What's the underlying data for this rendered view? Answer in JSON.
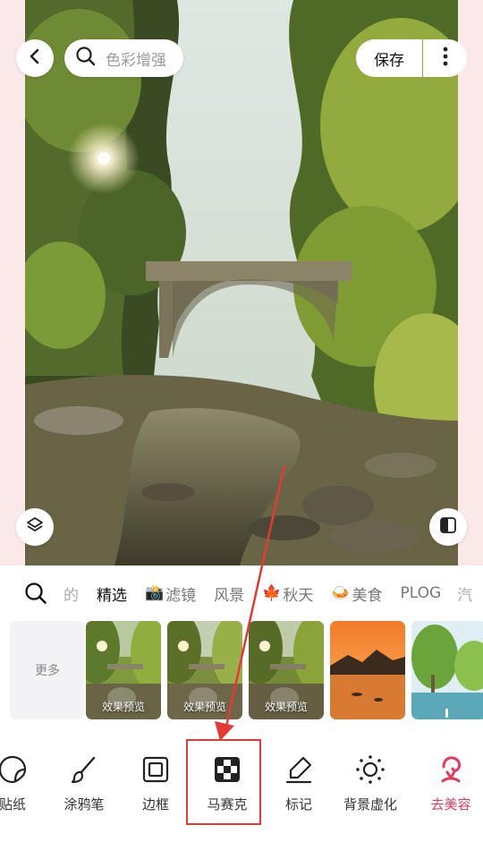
{
  "header": {
    "search_placeholder": "色彩增强",
    "save_label": "保存"
  },
  "filter_tabs": {
    "items": [
      {
        "label": "的",
        "emoji": "",
        "state": "partial"
      },
      {
        "label": "精选",
        "emoji": "",
        "state": "active"
      },
      {
        "label": "滤镜",
        "emoji": "📸",
        "state": "normal"
      },
      {
        "label": "风景",
        "emoji": "",
        "state": "normal"
      },
      {
        "label": "秋天",
        "emoji": "🍁",
        "state": "normal"
      },
      {
        "label": "美食",
        "emoji": "🍛",
        "state": "normal"
      },
      {
        "label": "PLOG",
        "emoji": "",
        "state": "normal"
      },
      {
        "label": "汽",
        "emoji": "",
        "state": "partial"
      }
    ]
  },
  "thumbnails": {
    "more_label": "更多",
    "preview_caption": "效果预览"
  },
  "tools": {
    "sticker": "贴纸",
    "brush": "涂鸦笔",
    "frame": "边框",
    "mosaic": "马赛克",
    "mark": "标记",
    "bg_blur": "背景虚化",
    "beauty": "去美容"
  },
  "colors": {
    "accent_red": "#e23a35",
    "beauty_pink": "#e33a5e",
    "photo_margin": "#fbe9e9"
  },
  "icons": [
    "chevron-left-icon",
    "search-icon",
    "more-vertical-icon",
    "layers-icon",
    "compare-icon",
    "sticker-icon",
    "brush-icon",
    "frame-icon",
    "mosaic-icon",
    "marker-icon",
    "bg-blur-icon",
    "beauty-icon"
  ]
}
